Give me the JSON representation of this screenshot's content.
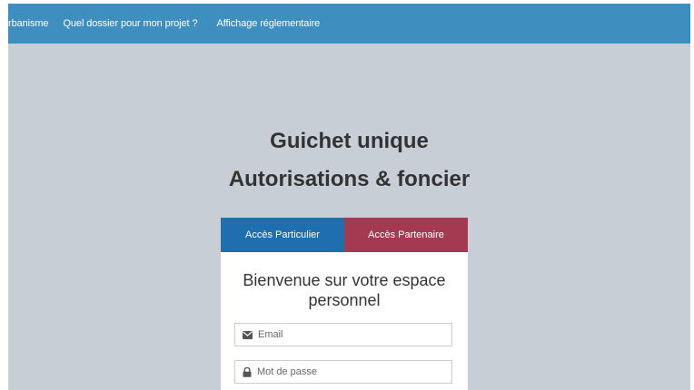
{
  "nav": {
    "items": [
      "rbanisme",
      "Quel dossier pour mon projet ?",
      "Affichage réglementaire"
    ]
  },
  "hero": {
    "title": "Guichet unique",
    "subtitle": "Autorisations & foncier"
  },
  "tabs": {
    "particulier": "Accès Particulier",
    "partenaire": "Accès Partenaire"
  },
  "login": {
    "welcome": "Bienvenue sur votre espace personnel",
    "email_placeholder": "Email",
    "password_placeholder": "Mot de passe",
    "email_icon": "envelope-icon",
    "password_icon": "lock-icon"
  },
  "colors": {
    "navbar": "#3e8fc0",
    "background": "#c8ced6",
    "tab_particulier": "#1f6fae",
    "tab_partenaire": "#a33a52"
  }
}
